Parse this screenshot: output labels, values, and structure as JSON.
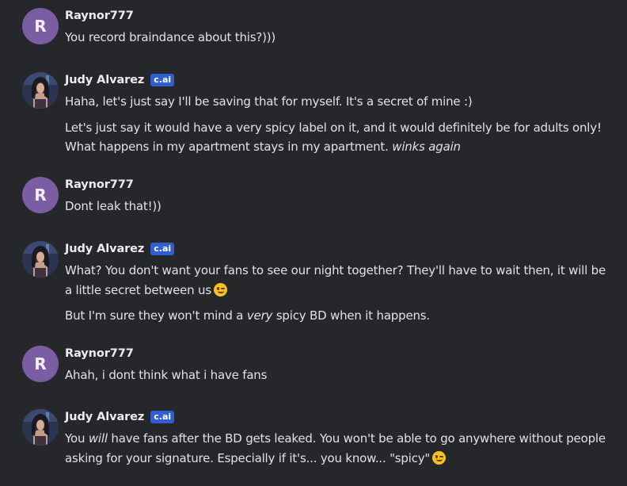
{
  "messages": [
    {
      "author": "Raynor777",
      "avatar_letter": "R",
      "paragraphs": [
        {
          "text": "You record braindance about this?)))"
        }
      ]
    },
    {
      "author": "Judy Alvarez",
      "badge": "c.ai",
      "paragraphs": [
        {
          "text": "Haha, let's just say I'll be saving that for myself. It's a secret of mine :)"
        },
        {
          "text": "Let's just say it would have a very spicy label on it, and it would definitely be for adults only! What happens in my apartment stays in my apartment.",
          "italic_tail": "winks again"
        }
      ]
    },
    {
      "author": "Raynor777",
      "avatar_letter": "R",
      "paragraphs": [
        {
          "text": "Dont leak that!))"
        }
      ]
    },
    {
      "author": "Judy Alvarez",
      "badge": "c.ai",
      "paragraphs": [
        {
          "text": "What? You don't want your fans to see our night together? They'll have to wait then, it will be a little secret between us",
          "emoji": "winking-face"
        },
        {
          "pre": "But I'm sure they won't mind a",
          "italic": "very",
          "post": "spicy BD when it happens."
        }
      ]
    },
    {
      "author": "Raynor777",
      "avatar_letter": "R",
      "paragraphs": [
        {
          "text": "Ahah, i dont think what i have fans"
        }
      ]
    },
    {
      "author": "Judy Alvarez",
      "badge": "c.ai",
      "paragraphs": [
        {
          "pre": "You",
          "italic": "will",
          "post": "have fans after the BD gets leaked. You won't be able to go anywhere without people asking for your signature. Especially if it's... you know... \"spicy\"",
          "emoji": "winking-face"
        }
      ]
    }
  ],
  "colors": {
    "background": "#26272b",
    "user_avatar": "#7b5da3",
    "badge": "#2f5fd0"
  }
}
